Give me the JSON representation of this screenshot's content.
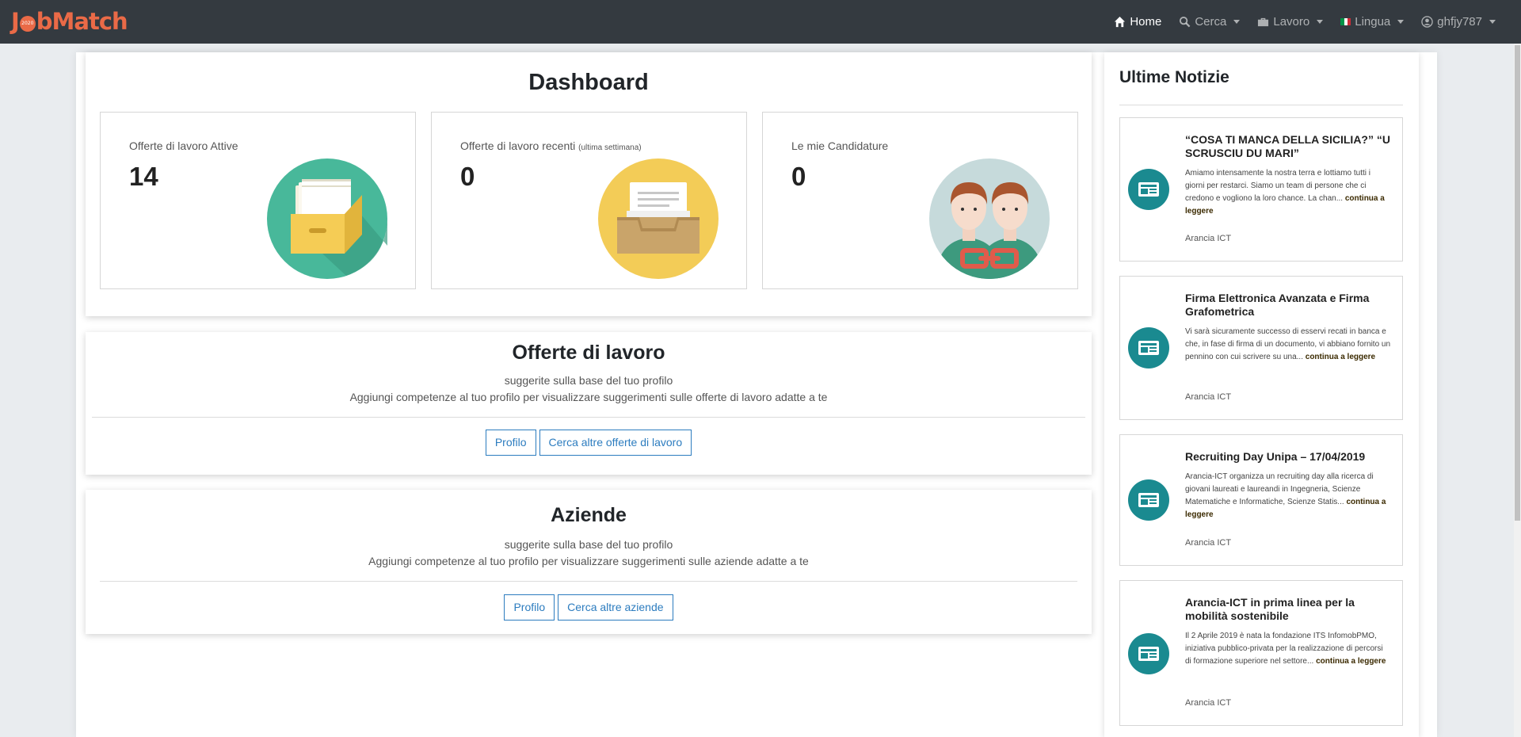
{
  "navbar": {
    "brand_left": "J",
    "brand_right": "bMatch",
    "brand_badge": "2020",
    "items": [
      {
        "label": "Home",
        "icon": "home-icon"
      },
      {
        "label": "Cerca",
        "icon": "search-icon"
      },
      {
        "label": "Lavoro",
        "icon": "briefcase-icon"
      },
      {
        "label": "Lingua",
        "icon": "flag-icon"
      },
      {
        "label": "ghfjy787",
        "icon": "user-icon"
      }
    ]
  },
  "dashboard": {
    "title": "Dashboard",
    "stats": [
      {
        "label": "Offerte di lavoro Attive",
        "label_small": "",
        "value": "14"
      },
      {
        "label": "Offerte di lavoro recenti",
        "label_small": "(ultima settimana)",
        "value": "0"
      },
      {
        "label": "Le mie Candidature",
        "label_small": "",
        "value": "0"
      }
    ]
  },
  "offerte": {
    "title": "Offerte di lavoro",
    "subtitle": "suggerite sulla base del tuo profilo",
    "hint": "Aggiungi competenze al tuo profilo per visualizzare suggerimenti sulle offerte di lavoro adatte a te",
    "btn_profile": "Profilo",
    "btn_search": "Cerca altre offerte di lavoro"
  },
  "aziende": {
    "title": "Aziende",
    "subtitle": "suggerite sulla base del tuo profilo",
    "hint": "Aggiungi competenze al tuo profilo per visualizzare suggerimenti sulle aziende adatte a te",
    "btn_profile": "Profilo",
    "btn_search": "Cerca altre aziende"
  },
  "news": {
    "title": "Ultime Notizie",
    "more_label": "continua a leggere",
    "items": [
      {
        "title": "“COSA TI MANCA DELLA SICILIA?” “U SCRUSCIU DU MARI”",
        "text": "Amiamo intensamente la nostra terra e lottiamo tutti i giorni per restarci. Siamo un team di persone che ci credono e vogliono la loro chance. La chan...",
        "author": "Arancia ICT"
      },
      {
        "title": "Firma Elettronica Avanzata e Firma Grafometrica",
        "text": "Vi sarà sicuramente successo di esservi recati in banca e che, in fase di firma di un documento, vi abbiano fornito un pennino con cui scrivere su una...",
        "author": "Arancia ICT"
      },
      {
        "title": "Recruiting Day Unipa – 17/04/2019",
        "text": "Arancia-ICT organizza un recruiting day alla ricerca di giovani laureati e laureandi in Ingegneria, Scienze Matematiche e Informatiche, Scienze Statis...",
        "author": "Arancia ICT"
      },
      {
        "title": "Arancia-ICT in prima linea per la mobilità sostenibile",
        "text": "Il 2 Aprile 2019 è nata la fondazione ITS InfomobPMO, iniziativa pubblico-privata per la realizzazione di percorsi di formazione superiore nel settore...",
        "author": "Arancia ICT"
      }
    ]
  },
  "colors": {
    "navbar": "#343a40",
    "brand": "#ea6a47",
    "button": "#2c7cbf",
    "news_icon": "#1a8a90"
  }
}
